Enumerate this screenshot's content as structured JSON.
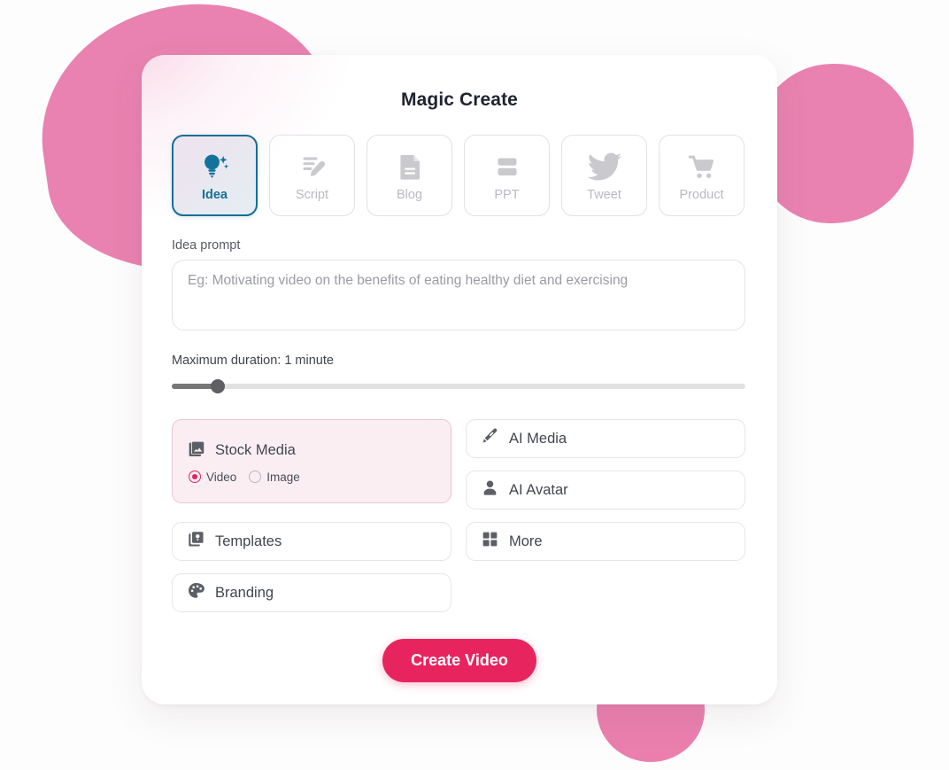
{
  "window": {
    "title": "Magic Create"
  },
  "tabs": [
    {
      "label": "Idea",
      "icon": "lightbulb-sparkle-icon",
      "active": true
    },
    {
      "label": "Script",
      "icon": "script-pencil-icon",
      "active": false
    },
    {
      "label": "Blog",
      "icon": "document-icon",
      "active": false
    },
    {
      "label": "PPT",
      "icon": "slides-icon",
      "active": false
    },
    {
      "label": "Tweet",
      "icon": "twitter-bird-icon",
      "active": false
    },
    {
      "label": "Product",
      "icon": "shopping-cart-icon",
      "active": false
    }
  ],
  "prompt": {
    "label": "Idea prompt",
    "value": "",
    "placeholder": "Eg: Motivating video on the benefits of eating healthy diet and exercising"
  },
  "duration": {
    "label": "Maximum duration: 1 minute",
    "value": "1 minute",
    "percent": 8
  },
  "options": {
    "stock_media": {
      "label": "Stock Media",
      "icon": "stacked-images-icon",
      "radios": [
        {
          "label": "Video",
          "checked": true
        },
        {
          "label": "Image",
          "checked": false
        }
      ]
    },
    "ai_media": {
      "label": "AI Media",
      "icon": "magic-wand-icon"
    },
    "templates": {
      "label": "Templates",
      "icon": "stacked-cards-icon"
    },
    "ai_avatar": {
      "label": "AI Avatar",
      "icon": "person-icon"
    },
    "branding": {
      "label": "Branding",
      "icon": "palette-icon"
    },
    "more": {
      "label": "More",
      "icon": "grid-squares-icon"
    }
  },
  "cta": {
    "label": "Create Video"
  },
  "colors": {
    "accent_pink": "#e8245f",
    "active_tab": "#146f94",
    "blob_pink": "#e982b0"
  }
}
